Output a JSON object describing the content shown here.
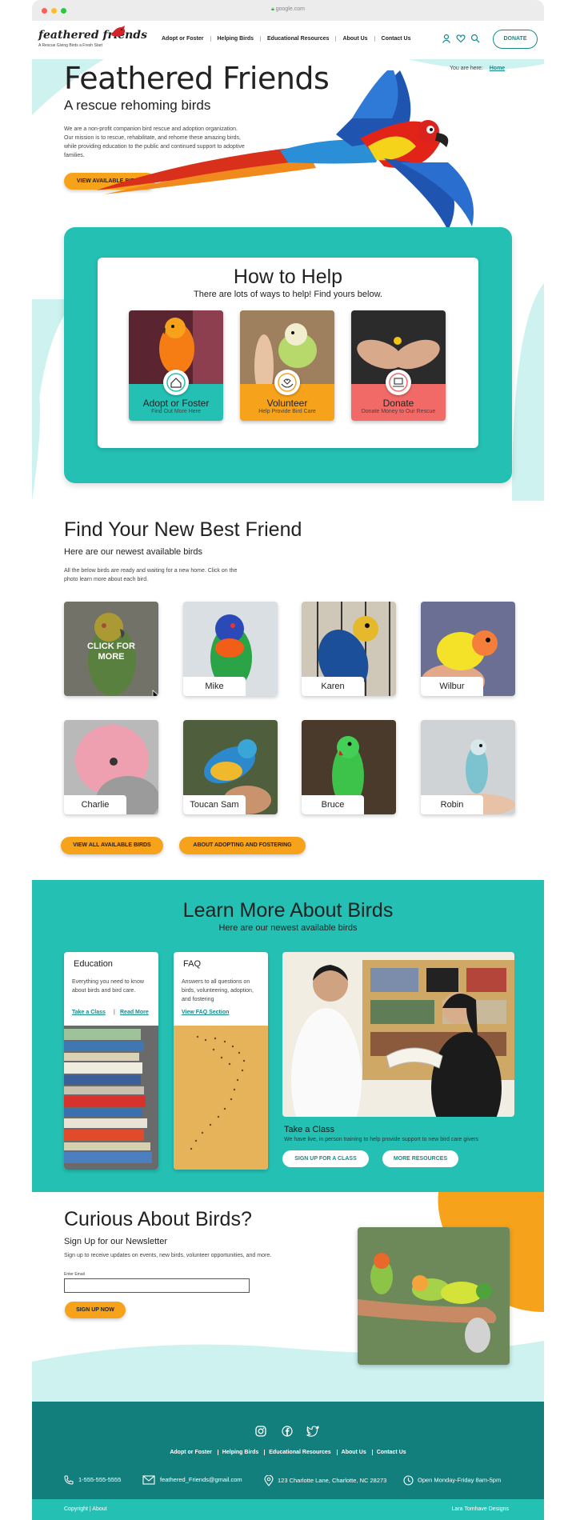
{
  "browser": {
    "url": "google.com"
  },
  "logo": {
    "name": "feathered friends",
    "tagline": "A Rescue Giving Birds a Fresh Start"
  },
  "nav": {
    "links": [
      "Adopt or Foster",
      "Helping Birds",
      "Educational Resources",
      "About Us",
      "Contact Us"
    ],
    "donate_label": "DONATE"
  },
  "breadcrumb": {
    "prefix": "You are here:",
    "current": "Home"
  },
  "hero": {
    "title": "Feathered Friends",
    "subtitle": "A rescue rehoming birds",
    "body": "We are a non-profit companion bird rescue and adoption organization. Our mission is to rescue, rehabilitate, and rehome these amazing birds, while providing education to the public and continued support to adoptive families.",
    "cta": "VIEW AVAILABLE BIRDS"
  },
  "help": {
    "title": "How to Help",
    "subtitle": "There are lots of ways to help! Find yours below.",
    "cards": [
      {
        "title": "Adopt or Foster",
        "sub": "Find Out More Here",
        "color": "#24c0b4",
        "icon": "home-heart-icon"
      },
      {
        "title": "Volunteer",
        "sub": "Help Provide Bird Care",
        "color": "#f7a21b",
        "icon": "hands-heart-icon"
      },
      {
        "title": "Donate",
        "sub": "Donate Money to Our Rescue",
        "color": "#f16a67",
        "icon": "money-hand-icon"
      }
    ]
  },
  "find": {
    "title": "Find Your New Best Friend",
    "subtitle": "Here are our newest available birds",
    "body": "All the below birds are ready and waiting for a new home. Click on the photo learn more about each bird.",
    "hover_text": "CLICK FOR MORE",
    "birds": [
      "",
      "Mike",
      "Karen",
      "Wilbur",
      "Charlie",
      "Toucan Sam",
      "Bruce",
      "Robin"
    ],
    "btn_all": "VIEW ALL AVAILABLE BIRDS",
    "btn_adopt": "ABOUT ADOPTING AND FOSTERING"
  },
  "learn": {
    "title": "Learn More About Birds",
    "subtitle": "Here are our newest available birds",
    "education": {
      "title": "Education",
      "text": "Everything you need to know about birds and bird care.",
      "link1": "Take a Class",
      "sep": "|",
      "link2": "Read More"
    },
    "faq": {
      "title": "FAQ",
      "text": "Answers to all questions on birds, volunteering, adoption, and fostering",
      "link": "View FAQ Section"
    },
    "class": {
      "title": "Take a Class",
      "text": "We have live, in person training to help provide support to new bird care givers",
      "btn1": "SIGN UP FOR A CLASS",
      "btn2": "MORE RESOURCES"
    }
  },
  "newsletter": {
    "title": "Curious About Birds?",
    "subtitle": "Sign Up for our Newsletter",
    "body": "Sign up to receive updates on events, new birds, volunteer opportunities, and more.",
    "email_label": "Enter Email",
    "email_value": "",
    "btn": "SIGN UP NOW"
  },
  "footer": {
    "links": [
      "Adopt or Foster",
      "Helping Birds",
      "Educational Resources",
      "About Us",
      "Contact Us"
    ],
    "phone": "1-555-555-5555",
    "email": "feathered_Friends@gmail.com",
    "address": "123 Charlotte Lane, Charlotte, NC 28273",
    "hours": "Open Monday-Friday 8am-5pm",
    "copyright": "Copyright | About",
    "credit": "Lara Tomhave Designs"
  },
  "colors": {
    "teal": "#24c0b4",
    "dark_teal": "#137f7d",
    "orange": "#f7a21b",
    "coral": "#f16a67",
    "light_teal": "#cdf2ef"
  }
}
